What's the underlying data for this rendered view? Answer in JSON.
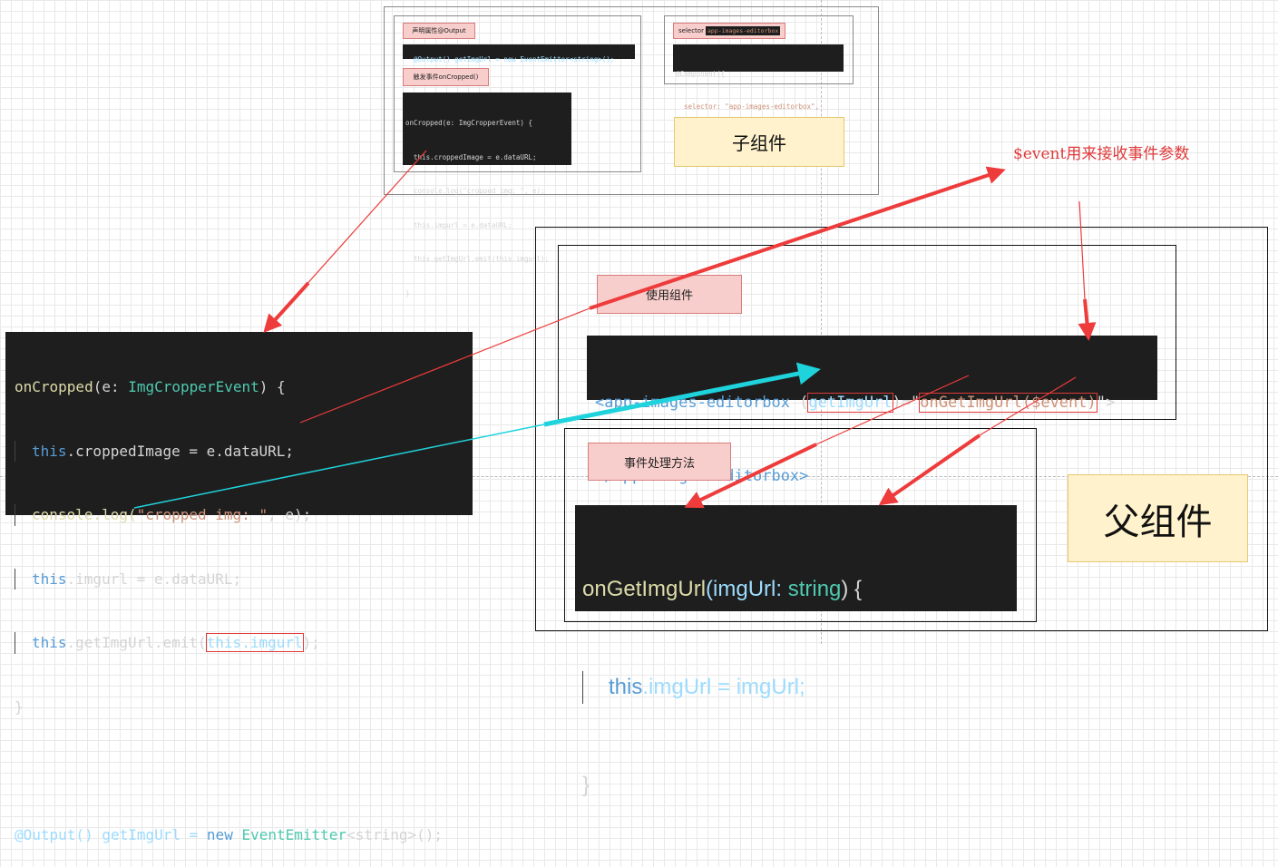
{
  "child": {
    "label_output": "声明属性@Output",
    "output_code": "@Output() getImgUrl = new EventEmitter<string>();",
    "label_trigger": "触发事件onCropped()",
    "small_code": [
      "onCropped(e: ImgCropperEvent) {",
      "  this.croppedImage = e.dataURL;",
      "  console.log(\"cropped img: \", e);",
      "  this.imgurl = e.dataURL;",
      "  this.getImgUrl.emit(this.imgurl);",
      "}"
    ],
    "selector_label": "selector",
    "selector_value": "app-images-editorbox",
    "component_code_1": "@Component({",
    "component_code_2": "  selector: \"app-images-editorbox\",",
    "title": "子组件"
  },
  "left_code": {
    "line1_fn": "onCropped",
    "line1_rest": "(e: ",
    "line1_type": "ImgCropperEvent",
    "line1_end": ") {",
    "line2_this": "this",
    "line2_rest": ".croppedImage = e.dataURL;",
    "line3_fn": "console.log(",
    "line3_str": "\"cropped img: \"",
    "line3_end": ", e);",
    "line4_this": "this",
    "line4_rest": ".imgurl = e.dataURL;",
    "line5_this": "this",
    "line5_rest": ".getImgUrl.emit(",
    "line5_hl": "this.imgurl",
    "line5_end": ");",
    "line6": "}",
    "line8_a": "@Output() getImgUrl = ",
    "line8_new": "new",
    "line8_type": " EventEmitter",
    "line8_b": "<string>();"
  },
  "parent": {
    "label_use": "使用组件",
    "tag_open": "<app-images-editorbox ",
    "attr_hl": "getImgUrl",
    "attr_paren_open": "(",
    "attr_paren_close": ")",
    "eq": "=\"",
    "value_hl": "onGetImgUrl($event)",
    "close_quote": "\">",
    "tag_close": "</app-images-editorbox>",
    "label_handler": "事件处理方法",
    "handler_fn": "onGetImgUrl",
    "handler_params": "(imgUrl: ",
    "handler_type": "string",
    "handler_end": ") {",
    "handler_this": "this",
    "handler_body": ".imgUrl = imgUrl;",
    "handler_close": "}",
    "title": "父组件"
  },
  "annotation": "$event用来接收事件参数",
  "colors": {
    "arrow_red": "#ee3b3b",
    "arrow_cyan": "#1fd3dc",
    "pink": "#f8cecc",
    "yellow": "#fff2cc",
    "code_bg": "#1e1e1e"
  }
}
